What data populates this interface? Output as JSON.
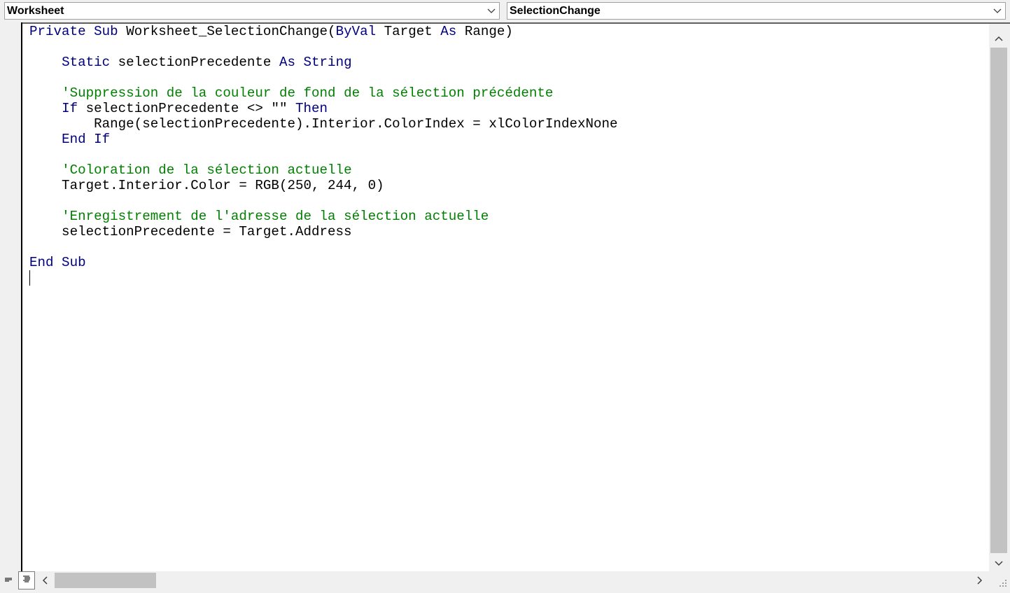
{
  "object_combo": {
    "value": "Worksheet"
  },
  "procedure_combo": {
    "value": "SelectionChange"
  },
  "code": {
    "lines": [
      [
        {
          "t": "kw",
          "v": "Private Sub "
        },
        {
          "t": "tx",
          "v": "Worksheet_SelectionChange("
        },
        {
          "t": "kw",
          "v": "ByVal "
        },
        {
          "t": "tx",
          "v": "Target "
        },
        {
          "t": "kw",
          "v": "As "
        },
        {
          "t": "tx",
          "v": "Range)"
        }
      ],
      [],
      [
        {
          "t": "tx",
          "v": "    "
        },
        {
          "t": "kw",
          "v": "Static "
        },
        {
          "t": "tx",
          "v": "selectionPrecedente "
        },
        {
          "t": "kw",
          "v": "As String"
        }
      ],
      [],
      [
        {
          "t": "tx",
          "v": "    "
        },
        {
          "t": "cm",
          "v": "'Suppression de la couleur de fond de la sélection précédente"
        }
      ],
      [
        {
          "t": "tx",
          "v": "    "
        },
        {
          "t": "kw",
          "v": "If "
        },
        {
          "t": "tx",
          "v": "selectionPrecedente <> \"\" "
        },
        {
          "t": "kw",
          "v": "Then"
        }
      ],
      [
        {
          "t": "tx",
          "v": "        Range(selectionPrecedente).Interior.ColorIndex = xlColorIndexNone"
        }
      ],
      [
        {
          "t": "tx",
          "v": "    "
        },
        {
          "t": "kw",
          "v": "End If"
        }
      ],
      [],
      [
        {
          "t": "tx",
          "v": "    "
        },
        {
          "t": "cm",
          "v": "'Coloration de la sélection actuelle"
        }
      ],
      [
        {
          "t": "tx",
          "v": "    Target.Interior.Color = RGB(250, 244, 0)"
        }
      ],
      [],
      [
        {
          "t": "tx",
          "v": "    "
        },
        {
          "t": "cm",
          "v": "'Enregistrement de l'adresse de la sélection actuelle"
        }
      ],
      [
        {
          "t": "tx",
          "v": "    selectionPrecedente = Target.Address"
        }
      ],
      [],
      [
        {
          "t": "kw",
          "v": "End Sub"
        }
      ],
      []
    ]
  },
  "colors": {
    "keyword": "#00007f",
    "comment": "#007f00",
    "text": "#000000",
    "scroll_thumb": "#c2c2c2"
  },
  "icons": {
    "combo_arrow": "chevron-down-icon",
    "scroll_up": "chevron-up-icon",
    "scroll_down": "chevron-down-icon",
    "scroll_left": "chevron-left-icon",
    "scroll_right": "chevron-right-icon",
    "procedure_view": "procedure-view-icon",
    "full_module_view": "full-module-view-icon",
    "size_grip": "size-grip-icon"
  }
}
